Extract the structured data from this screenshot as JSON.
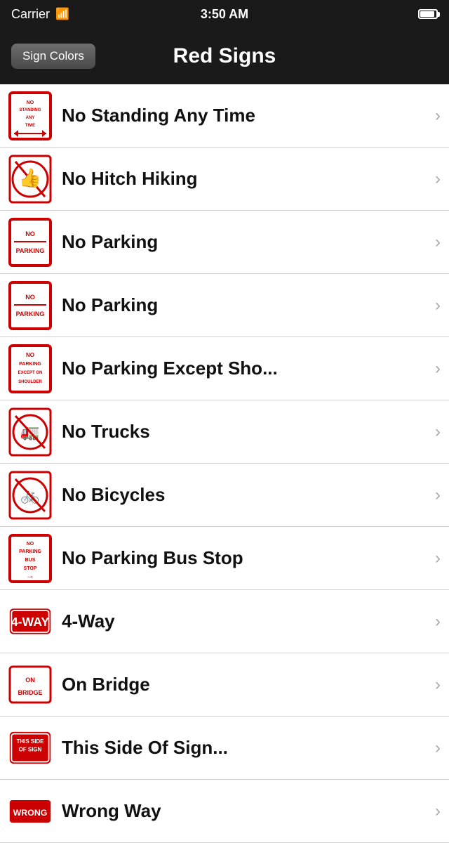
{
  "statusBar": {
    "carrier": "Carrier",
    "time": "3:50 AM"
  },
  "navBar": {
    "backLabel": "Sign Colors",
    "title": "Red Signs"
  },
  "items": [
    {
      "id": "no-standing",
      "label": "No Standing Any Time",
      "signType": "no-standing"
    },
    {
      "id": "no-hitch-hiking",
      "label": "No Hitch Hiking",
      "signType": "no-hitch-hiking"
    },
    {
      "id": "no-parking-1",
      "label": "No Parking",
      "signType": "no-parking"
    },
    {
      "id": "no-parking-2",
      "label": "No Parking",
      "signType": "no-parking"
    },
    {
      "id": "no-parking-shoulder",
      "label": "No Parking Except Sho...",
      "signType": "no-parking-shoulder"
    },
    {
      "id": "no-trucks",
      "label": "No Trucks",
      "signType": "no-trucks"
    },
    {
      "id": "no-bicycles",
      "label": "No Bicycles",
      "signType": "no-bicycles"
    },
    {
      "id": "no-parking-bus-stop",
      "label": "No Parking Bus Stop",
      "signType": "no-parking-bus-stop"
    },
    {
      "id": "four-way",
      "label": "4-Way",
      "signType": "four-way"
    },
    {
      "id": "on-bridge",
      "label": "On Bridge",
      "signType": "on-bridge"
    },
    {
      "id": "this-side-of-sign",
      "label": "This Side Of Sign...",
      "signType": "this-side-of-sign"
    },
    {
      "id": "wrong-way",
      "label": "Wrong Way",
      "signType": "wrong-way"
    }
  ],
  "chevron": "›"
}
